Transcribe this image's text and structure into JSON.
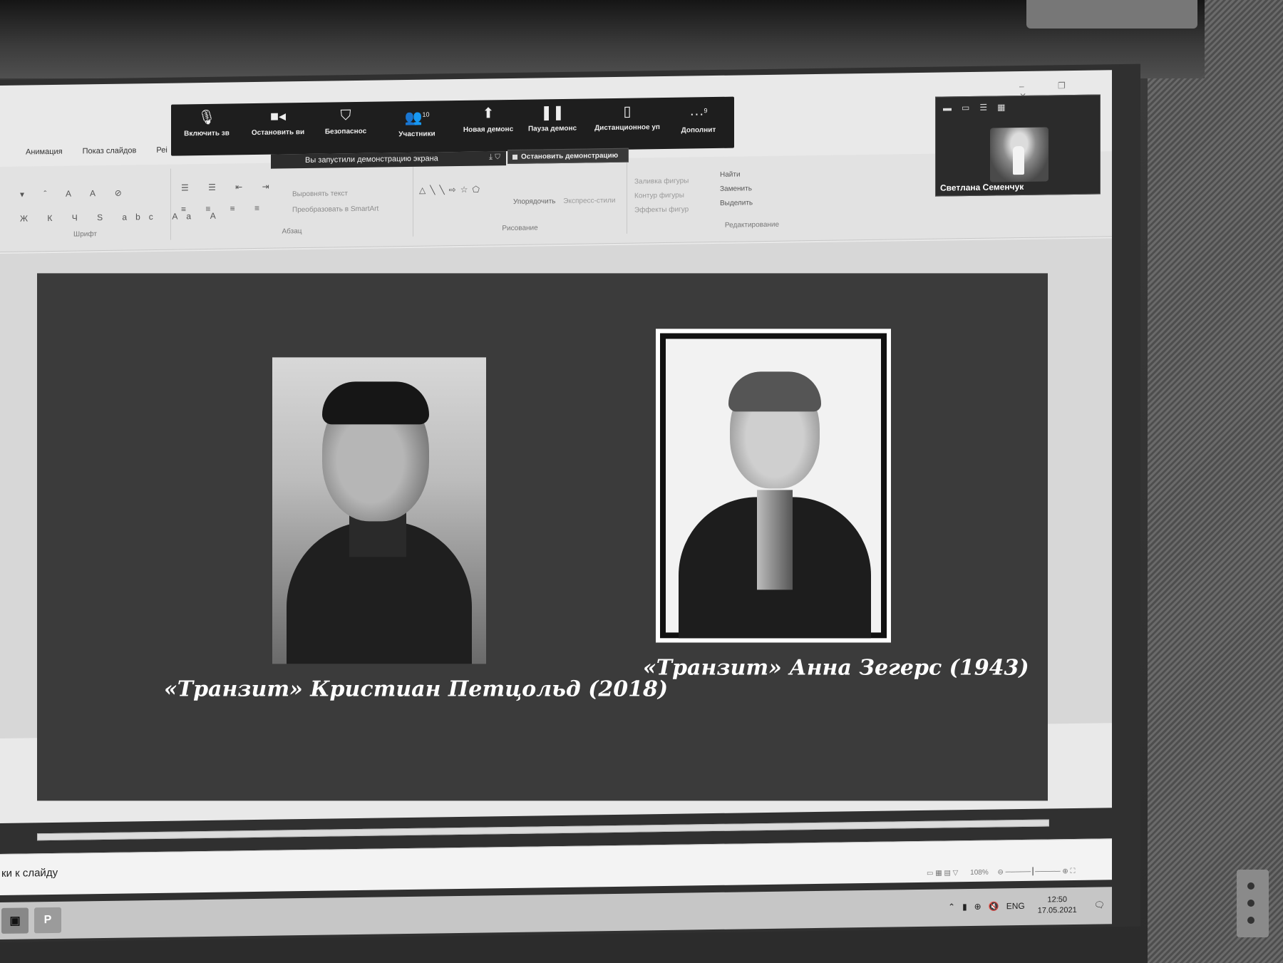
{
  "ribbon": {
    "tabs": [
      "Анимация",
      "Показ слайдов",
      "Реі"
    ],
    "groups": {
      "font": "Шрифт",
      "paragraph": "Абзац",
      "drawing": "Рисование",
      "editing": "Редактирование"
    },
    "paragraph_items": [
      "Выровнять текст",
      "Преобразовать в SmartArt"
    ],
    "drawing_items": [
      "Упорядочить",
      "Экспресс-стили"
    ],
    "shape_items": [
      "Заливка фигуры",
      "Контур фигуры",
      "Эффекты фигур"
    ],
    "editing_items": [
      "Найти",
      "Заменить",
      "Выделить"
    ]
  },
  "zoom_toolbar": {
    "buttons": [
      {
        "label": "Включить зв",
        "icon": "microphone-icon"
      },
      {
        "label": "Остановить ви",
        "icon": "video-camera-icon"
      },
      {
        "label": "Безопаснос",
        "icon": "shield-icon"
      },
      {
        "label": "Участники",
        "icon": "participants-icon",
        "count": "10"
      },
      {
        "label": "Новая демонс",
        "icon": "share-screen-icon"
      },
      {
        "label": "Пауза демонс",
        "icon": "pause-icon"
      },
      {
        "label": "Дистанционное уп",
        "icon": "mouse-icon"
      },
      {
        "label": "Дополнит",
        "icon": "more-icon",
        "count": "9"
      }
    ],
    "notice": "Вы запустили демонстрацию экрана",
    "stop_share": "Остановить демонстрацию"
  },
  "participant_tile": {
    "name": "Светлана Семенчук"
  },
  "slide": {
    "left_caption": "«Транзит» Кристиан Петцольд (2018)",
    "right_caption": "«Транзит» Анна Зегерс (1943)"
  },
  "notes": {
    "placeholder_fragment": "ки к слайду"
  },
  "status_bar": {
    "zoom": "108%"
  },
  "taskbar": {
    "apps": [
      {
        "name": "photos-app-icon",
        "glyph": "▣"
      },
      {
        "name": "powerpoint-app-icon",
        "glyph": "P"
      }
    ],
    "tray": {
      "language": "ENG",
      "time": "12:50",
      "date": "17.05.2021"
    }
  }
}
